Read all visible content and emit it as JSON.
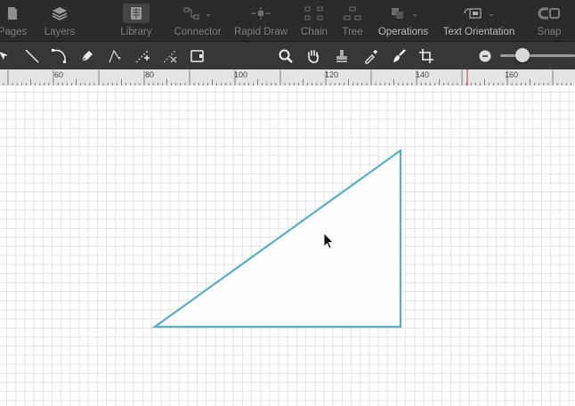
{
  "toolbar": {
    "pages": "Pages",
    "layers": "Layers",
    "library": "Library",
    "connector": "Connector",
    "rapid_draw": "Rapid Draw",
    "chain": "Chain",
    "tree": "Tree",
    "operations": "Operations",
    "text_orientation": "Text Orientation",
    "snap": "Snap"
  },
  "ruler": {
    "labels": [
      "60",
      "80",
      "100",
      "120",
      "140",
      "160"
    ]
  },
  "colors": {
    "shape_stroke": "#5aaec8",
    "toolbar_bg": "#2b2b2b",
    "ruler_marker": "#cc3333"
  }
}
